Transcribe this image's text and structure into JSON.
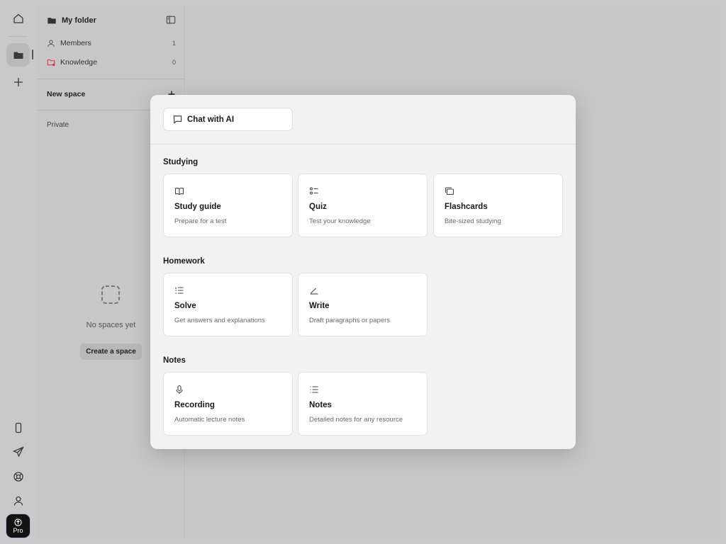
{
  "sidebar_rail": {
    "icons": [
      "home-icon",
      "folder-icon",
      "plus-icon",
      "phone-icon",
      "send-icon",
      "help-icon",
      "user-icon"
    ],
    "pro_label": "Pro"
  },
  "folder_panel": {
    "title": "My folder",
    "rows": [
      {
        "label": "Members",
        "count": "1"
      },
      {
        "label": "Knowledge",
        "count": "0"
      }
    ],
    "new_space_label": "New space",
    "private_label": "Private",
    "empty_text": "No spaces yet",
    "create_button": "Create a space"
  },
  "modal": {
    "chat_button": "Chat with AI",
    "sections": [
      {
        "title": "Studying",
        "cards": [
          {
            "title": "Study guide",
            "subtitle": "Prepare for a test",
            "icon": "book-icon"
          },
          {
            "title": "Quiz",
            "subtitle": "Test your knowledge",
            "icon": "checklist-icon"
          },
          {
            "title": "Flashcards",
            "subtitle": "Bite-sized studying",
            "icon": "cards-icon"
          }
        ]
      },
      {
        "title": "Homework",
        "cards": [
          {
            "title": "Solve",
            "subtitle": "Get answers and explanations",
            "icon": "numbered-list-icon"
          },
          {
            "title": "Write",
            "subtitle": "Draft paragraphs or papers",
            "icon": "pen-icon"
          }
        ]
      },
      {
        "title": "Notes",
        "cards": [
          {
            "title": "Recording",
            "subtitle": "Automatic lecture notes",
            "icon": "microphone-icon"
          },
          {
            "title": "Notes",
            "subtitle": "Detailed notes for any resource",
            "icon": "list-icon"
          }
        ]
      }
    ]
  }
}
